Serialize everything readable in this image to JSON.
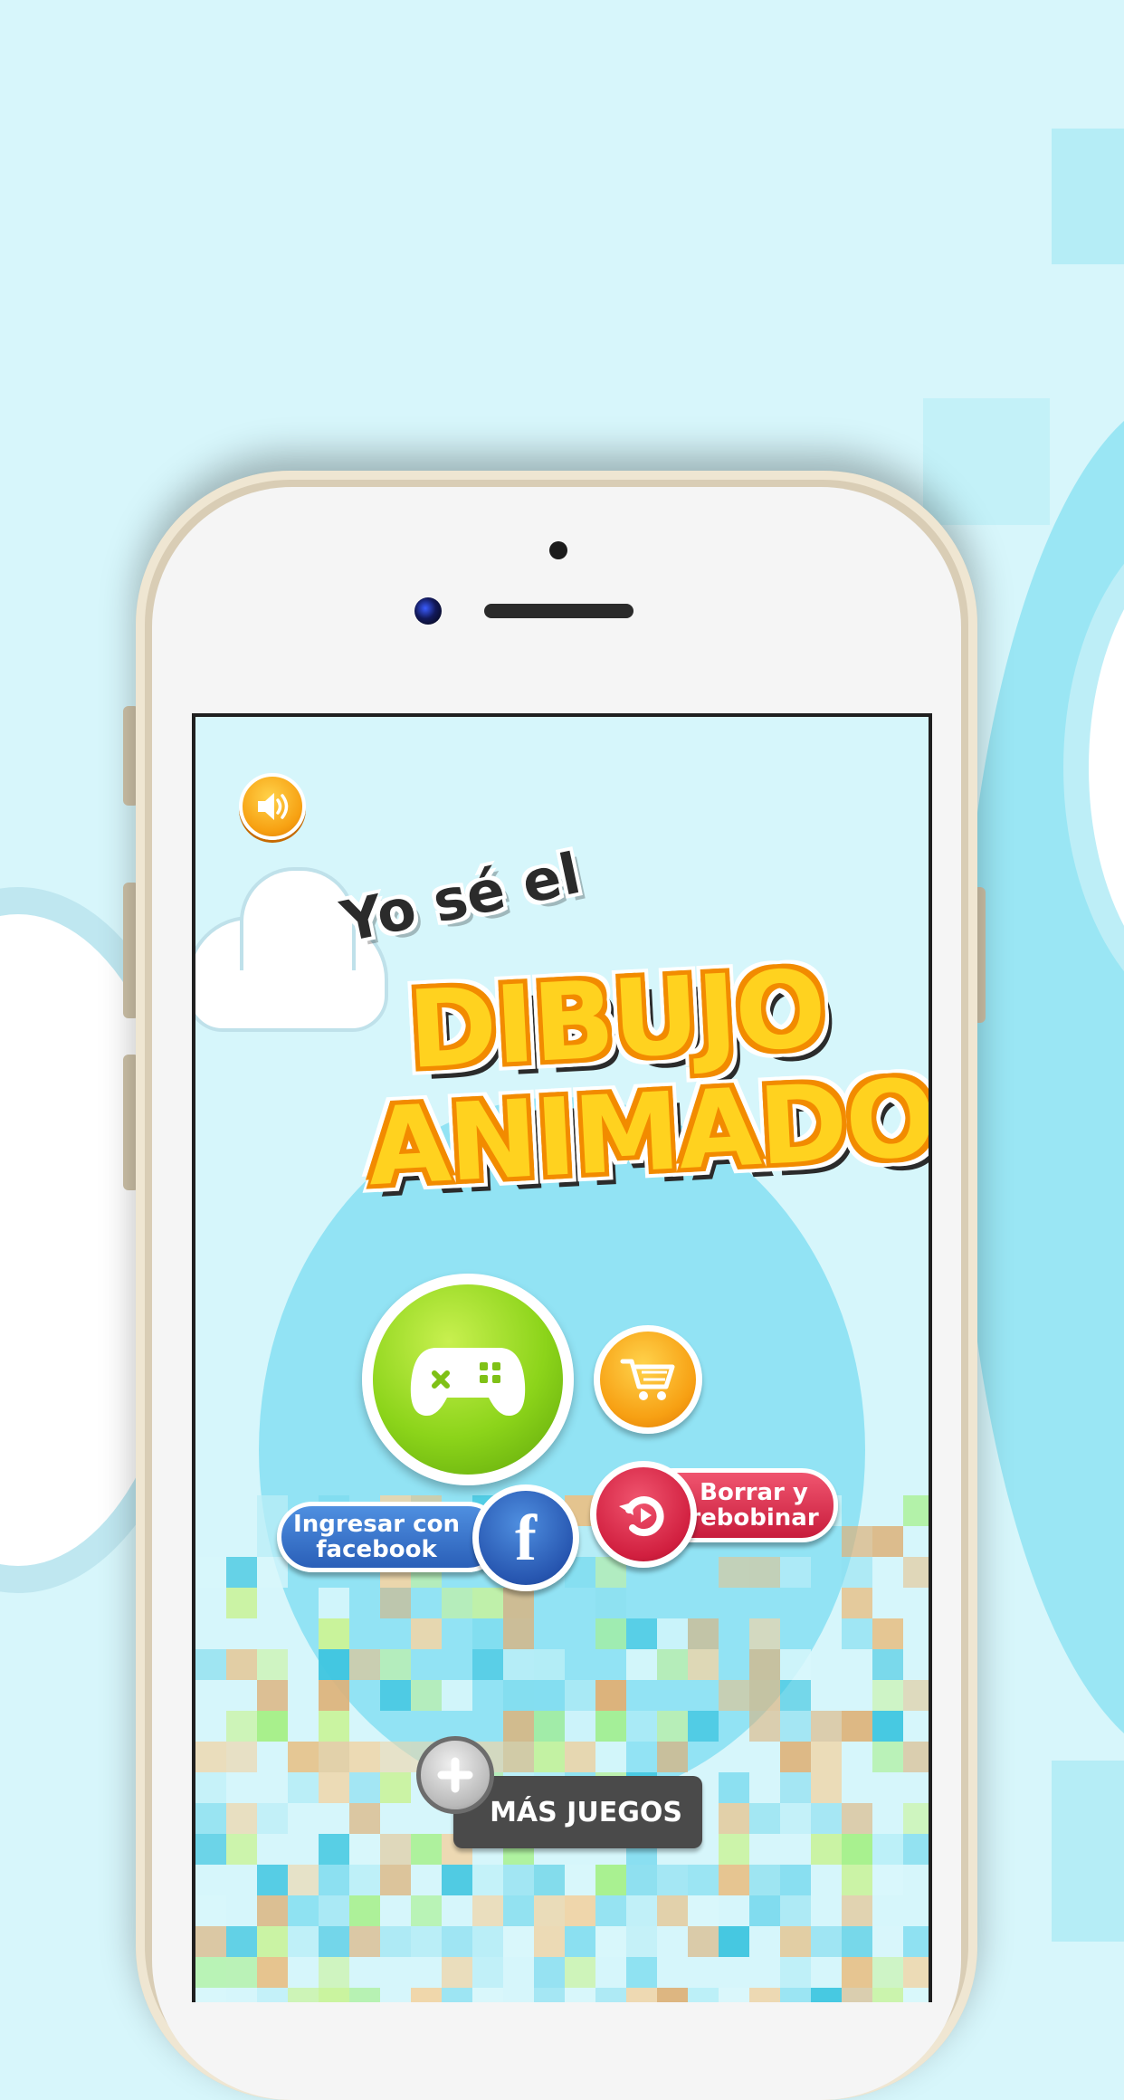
{
  "title": {
    "line_small": "Yo sé el",
    "line1": "DIBUJO",
    "line2": "ANIMADO"
  },
  "buttons": {
    "sound_icon": "speaker-icon",
    "play_icon": "gamepad-icon",
    "shop_icon": "cart-icon",
    "facebook_label": "Ingresar con facebook",
    "facebook_icon": "f",
    "reset_label": "Borrar y rebobinar",
    "reset_icon": "rewind-icon",
    "more_games_label": "MÁS JUEGOS",
    "more_games_icon": "plus-icon"
  },
  "colors": {
    "title_yellow": "#ffd21f",
    "play_green": "#8cd41a",
    "coin_orange": "#f7a013",
    "facebook_blue": "#2a5fb8",
    "reset_red": "#c81c3c",
    "more_gray": "#4a4a4a",
    "sky": "#d6f6fb"
  }
}
